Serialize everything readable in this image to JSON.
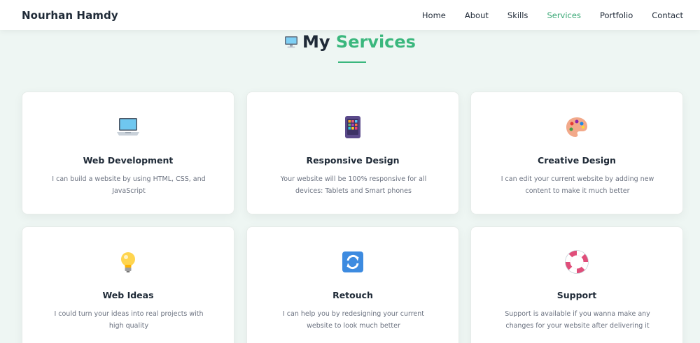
{
  "navbar": {
    "brand": "Nourhan Hamdy",
    "links": [
      {
        "label": "Home",
        "active": false
      },
      {
        "label": "About",
        "active": false
      },
      {
        "label": "Skills",
        "active": false
      },
      {
        "label": "Services",
        "active": true
      },
      {
        "label": "Portfolio",
        "active": false
      },
      {
        "label": "Contact",
        "active": false
      }
    ]
  },
  "section": {
    "title_prefix": "My",
    "title_accent": "Services",
    "title_icon": "computer-icon"
  },
  "colors": {
    "accent": "#3ab77d",
    "nav_active": "#3aa876",
    "background": "#eef6f3"
  },
  "services": [
    {
      "title": "Web Development",
      "description": "I can build a website by using HTML, CSS, and JavaScript",
      "icon": "laptop-icon"
    },
    {
      "title": "Responsive Design",
      "description": "Your website will be 100% responsive for all devices: Tablets and Smart phones",
      "icon": "tablet-icon"
    },
    {
      "title": "Creative Design",
      "description": "I can edit your current website by adding new content to make it much better",
      "icon": "palette-icon"
    },
    {
      "title": "Web Ideas",
      "description": "I could turn your ideas into real projects with high quality",
      "icon": "lightbulb-icon"
    },
    {
      "title": "Retouch",
      "description": "I can help you by redesigning your current website to look much better",
      "icon": "refresh-icon"
    },
    {
      "title": "Support",
      "description": "Support is available if you wanna make any changes for your website after delivering it",
      "icon": "lifebuoy-icon"
    }
  ]
}
